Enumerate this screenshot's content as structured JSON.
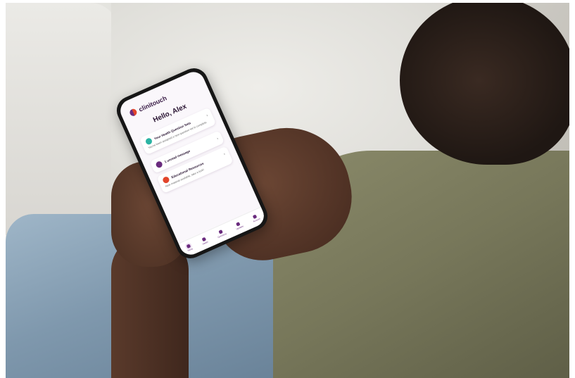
{
  "app": {
    "brand": "clinitouch",
    "greeting": "Hello, Alex"
  },
  "cards": [
    {
      "title": "Your Health Question Sets",
      "subtitle": "You've been assigned a new question set to complete",
      "icon": "heart-icon",
      "icon_color": "#2bb3a3"
    },
    {
      "title": "1 unread message",
      "subtitle": "",
      "icon": "message-icon",
      "icon_color": "#6a2b7e"
    },
    {
      "title": "Educational Resources",
      "subtitle": "New material available, take a look!",
      "icon": "book-icon",
      "icon_color": "#e2452b"
    }
  ],
  "nav": [
    {
      "label": "Home",
      "icon": "home-icon"
    },
    {
      "label": "Health",
      "icon": "health-icon"
    },
    {
      "label": "Questions",
      "icon": "questions-icon"
    },
    {
      "label": "Updates",
      "icon": "updates-icon"
    },
    {
      "label": "Account",
      "icon": "account-icon"
    }
  ],
  "colors": {
    "brand_purple": "#6a2b7e",
    "brand_orange": "#e2452b",
    "screen_bg": "#faf7fb"
  }
}
